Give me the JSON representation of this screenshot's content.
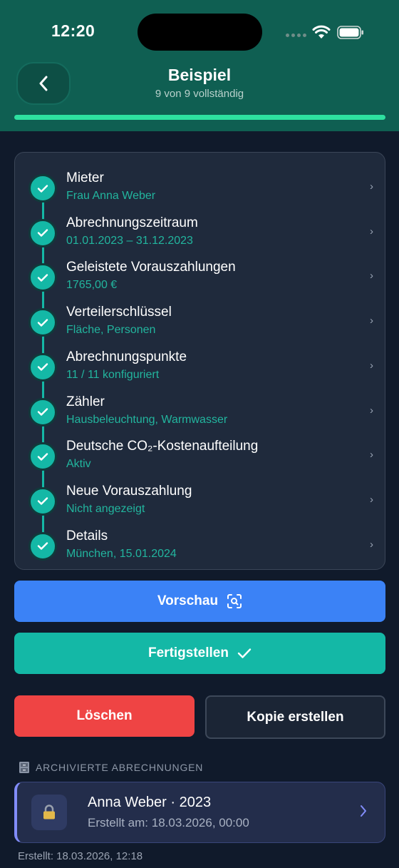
{
  "status_bar": {
    "time": "12:20"
  },
  "header": {
    "title": "Beispiel",
    "subtitle": "9 von 9 vollständig",
    "progress": 1.0
  },
  "steps": [
    {
      "title": "Mieter",
      "subtitle": "Frau Anna Weber"
    },
    {
      "title": "Abrechnungszeitraum",
      "subtitle": "01.01.2023 – 31.12.2023"
    },
    {
      "title": "Geleistete Vorauszahlungen",
      "subtitle": "1765,00 €"
    },
    {
      "title": "Verteilerschlüssel",
      "subtitle": "Fläche, Personen"
    },
    {
      "title": "Abrechnungspunkte",
      "subtitle": "11 / 11 konfiguriert"
    },
    {
      "title": "Zähler",
      "subtitle": "Hausbeleuchtung, Warmwasser"
    },
    {
      "title": "Deutsche CO₂-Kostenaufteilung",
      "subtitle": "Aktiv"
    },
    {
      "title": "Neue Vorauszahlung",
      "subtitle": "Nicht angezeigt"
    },
    {
      "title": "Details",
      "subtitle": "München, 15.01.2024"
    }
  ],
  "actions": {
    "preview": "Vorschau",
    "finish": "Fertigstellen",
    "delete": "Löschen",
    "copy": "Kopie erstellen"
  },
  "archive": {
    "section_label": "ARCHIVIERTE ABRECHNUNGEN",
    "section_icon": "file-cabinet-icon",
    "item": {
      "title": "Anna Weber · 2023",
      "subtitle": "Erstellt am: 18.03.2026, 00:00",
      "icon": "lock-icon"
    }
  },
  "footer": {
    "created": "Erstellt: 18.03.2026, 12:18"
  },
  "colors": {
    "header_bg": "#0f5f52",
    "accent_teal": "#14b8a6",
    "preview_blue": "#3b82f6",
    "delete_red": "#ef4444",
    "archive_accent": "#818cf8"
  }
}
